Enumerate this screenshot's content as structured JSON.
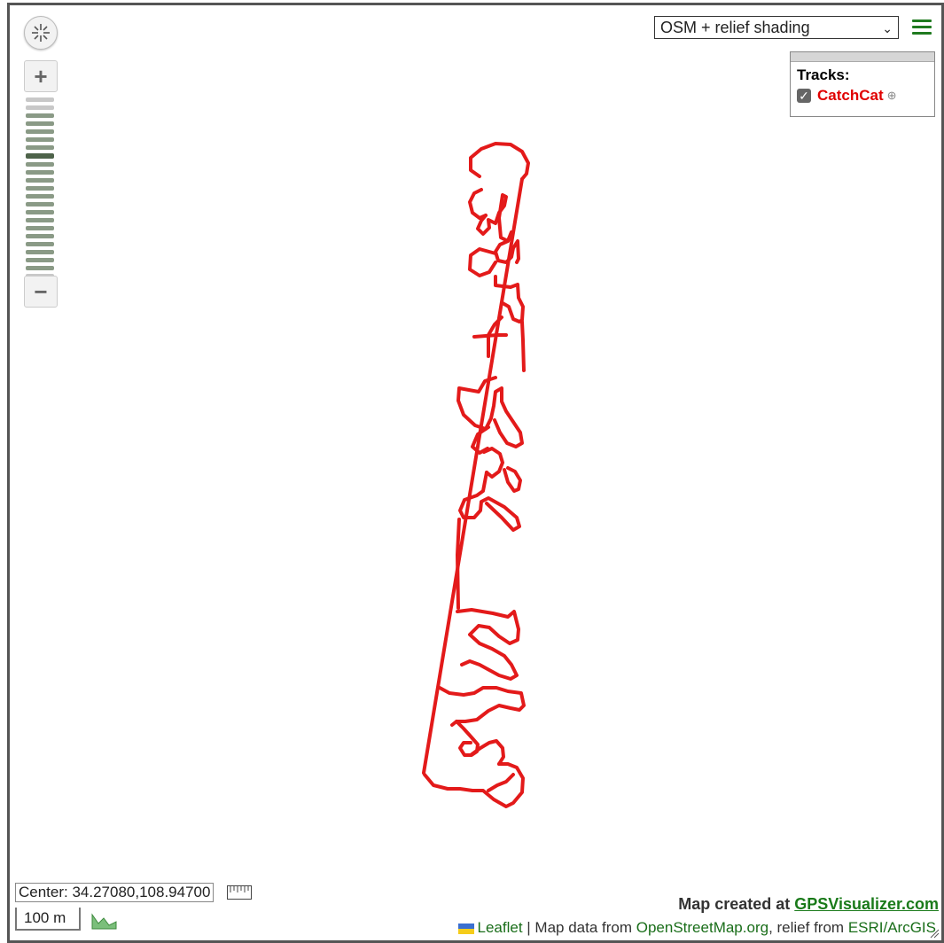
{
  "map": {
    "base_layer": "OSM + relief shading",
    "zoom_levels_total": 23,
    "zoom_level_active": 7
  },
  "tracks_panel": {
    "title": "Tracks:",
    "tracks": [
      {
        "name": "CatchCat",
        "checked": true,
        "color": "#e31a1a"
      }
    ]
  },
  "center": "Center: 34.27080,108.94700",
  "scale": "100 m",
  "credit": {
    "prefix": "Map created at ",
    "link": "GPSVisualizer.com"
  },
  "attribution": {
    "leaflet": "Leaflet",
    "sep1": " | Map data from ",
    "osm": "OpenStreetMap.org",
    "sep2": ", relief from ",
    "esri": "ESRI/ArcGIS"
  },
  "icons": [
    "recenter-icon",
    "zoom-in-icon",
    "zoom-out-icon",
    "menu-icon",
    "crosshair-icon",
    "ruler-icon",
    "elevation-profile-icon",
    "ukraine-flag-icon",
    "resize-icon"
  ],
  "colors": {
    "track": "#e31a1a",
    "accent": "#1f7a1f",
    "zoom_active": "#4e634a"
  }
}
